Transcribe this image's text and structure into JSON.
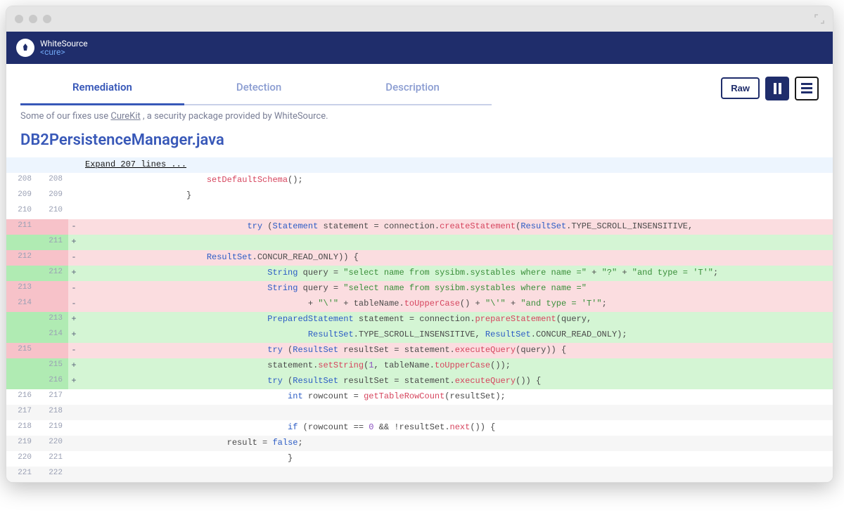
{
  "brand": {
    "name_top": "WhiteSource",
    "name_bottom": "<cure>"
  },
  "tabs": {
    "remediation": "Remediation",
    "detection": "Detection",
    "description": "Description"
  },
  "controls": {
    "raw": "Raw"
  },
  "info": {
    "prefix": "Some of our fixes use ",
    "link": "CureKit",
    "suffix": " , a security package provided by WhiteSource."
  },
  "file": {
    "name": "DB2PersistenceManager.java"
  },
  "expand": "Expand 207 lines ...",
  "diff": [
    {
      "t": "ctx",
      "ol": "208",
      "nl": "208",
      "segs": [
        [
          "pad",
          "                        "
        ],
        [
          "mth",
          "setDefaultSchema"
        ],
        [
          "op",
          "();"
        ]
      ]
    },
    {
      "t": "ctx",
      "ol": "209",
      "nl": "209",
      "segs": [
        [
          "pad",
          "                    "
        ],
        [
          "op",
          "}"
        ]
      ]
    },
    {
      "t": "ctx",
      "ol": "210",
      "nl": "210",
      "segs": [
        [
          "pad",
          ""
        ]
      ]
    },
    {
      "t": "del",
      "ol": "211",
      "nl": "",
      "segs": [
        [
          "pad",
          "                                "
        ],
        [
          "kw",
          "try"
        ],
        [
          "op",
          " ("
        ],
        [
          "type",
          "Statement"
        ],
        [
          "id",
          " statement "
        ],
        [
          "op",
          "= "
        ],
        [
          "id",
          "connection"
        ],
        [
          "op",
          "."
        ],
        [
          "mth",
          "createStatement"
        ],
        [
          "op",
          "("
        ],
        [
          "type",
          "ResultSet"
        ],
        [
          "op",
          "."
        ],
        [
          "id",
          "TYPE_SCROLL_INSENSITIVE"
        ],
        [
          "op",
          ","
        ]
      ]
    },
    {
      "t": "add",
      "ol": "",
      "nl": "211",
      "segs": [
        [
          "pad",
          ""
        ]
      ]
    },
    {
      "t": "del",
      "ol": "212",
      "nl": "",
      "segs": [
        [
          "pad",
          "                        "
        ],
        [
          "type",
          "ResultSet"
        ],
        [
          "op",
          "."
        ],
        [
          "id",
          "CONCUR_READ_ONLY"
        ],
        [
          "op",
          ")) {"
        ]
      ]
    },
    {
      "t": "add",
      "ol": "",
      "nl": "212",
      "segs": [
        [
          "pad",
          "                                    "
        ],
        [
          "type",
          "String"
        ],
        [
          "id",
          " query "
        ],
        [
          "op",
          "= "
        ],
        [
          "str",
          "\"select name from sysibm.systables where name =\""
        ],
        [
          "op",
          " + "
        ],
        [
          "str",
          "\"?\""
        ],
        [
          "op",
          " + "
        ],
        [
          "str",
          "\"and type = 'T'\""
        ],
        [
          "op",
          ";"
        ]
      ]
    },
    {
      "t": "del",
      "ol": "213",
      "nl": "",
      "segs": [
        [
          "pad",
          "                                    "
        ],
        [
          "type",
          "String"
        ],
        [
          "id",
          " query "
        ],
        [
          "op",
          "= "
        ],
        [
          "str",
          "\"select name from sysibm.systables where name =\""
        ]
      ]
    },
    {
      "t": "del",
      "ol": "214",
      "nl": "",
      "segs": [
        [
          "pad",
          "                                            "
        ],
        [
          "op",
          "+ "
        ],
        [
          "str",
          "\"\\'\""
        ],
        [
          "op",
          " + "
        ],
        [
          "id",
          "tableName"
        ],
        [
          "op",
          "."
        ],
        [
          "mth",
          "toUpperCase"
        ],
        [
          "op",
          "() + "
        ],
        [
          "str",
          "\"\\'\""
        ],
        [
          "op",
          " + "
        ],
        [
          "str",
          "\"and type = 'T'\""
        ],
        [
          "op",
          ";"
        ]
      ]
    },
    {
      "t": "add",
      "ol": "",
      "nl": "213",
      "segs": [
        [
          "pad",
          "                                    "
        ],
        [
          "type",
          "PreparedStatement"
        ],
        [
          "id",
          " statement "
        ],
        [
          "op",
          "= "
        ],
        [
          "id",
          "connection"
        ],
        [
          "op",
          "."
        ],
        [
          "mth",
          "prepareStatement"
        ],
        [
          "op",
          "("
        ],
        [
          "id",
          "query"
        ],
        [
          "op",
          ","
        ]
      ]
    },
    {
      "t": "add",
      "ol": "",
      "nl": "214",
      "segs": [
        [
          "pad",
          "                                            "
        ],
        [
          "type",
          "ResultSet"
        ],
        [
          "op",
          "."
        ],
        [
          "id",
          "TYPE_SCROLL_INSENSITIVE"
        ],
        [
          "op",
          ", "
        ],
        [
          "type",
          "ResultSet"
        ],
        [
          "op",
          "."
        ],
        [
          "id",
          "CONCUR_READ_ONLY"
        ],
        [
          "op",
          ");"
        ]
      ]
    },
    {
      "t": "del",
      "ol": "215",
      "nl": "",
      "segs": [
        [
          "pad",
          "                                    "
        ],
        [
          "kw",
          "try"
        ],
        [
          "op",
          " ("
        ],
        [
          "type",
          "ResultSet"
        ],
        [
          "id",
          " resultSet "
        ],
        [
          "op",
          "= "
        ],
        [
          "id",
          "statement"
        ],
        [
          "op",
          "."
        ],
        [
          "mth",
          "executeQuery"
        ],
        [
          "op",
          "("
        ],
        [
          "id",
          "query"
        ],
        [
          "op",
          ")) {"
        ]
      ]
    },
    {
      "t": "add",
      "ol": "",
      "nl": "215",
      "segs": [
        [
          "pad",
          "                                    "
        ],
        [
          "id",
          "statement"
        ],
        [
          "op",
          "."
        ],
        [
          "mth",
          "setString"
        ],
        [
          "op",
          "("
        ],
        [
          "num",
          "1"
        ],
        [
          "op",
          ", "
        ],
        [
          "id",
          "tableName"
        ],
        [
          "op",
          "."
        ],
        [
          "mth",
          "toUpperCase"
        ],
        [
          "op",
          "());"
        ]
      ]
    },
    {
      "t": "add",
      "ol": "",
      "nl": "216",
      "segs": [
        [
          "pad",
          "                                    "
        ],
        [
          "kw",
          "try"
        ],
        [
          "op",
          " ("
        ],
        [
          "type",
          "ResultSet"
        ],
        [
          "id",
          " resultSet "
        ],
        [
          "op",
          "= "
        ],
        [
          "id",
          "statement"
        ],
        [
          "op",
          "."
        ],
        [
          "mth",
          "executeQuery"
        ],
        [
          "op",
          "()) {"
        ]
      ]
    },
    {
      "t": "ctx",
      "ol": "216",
      "nl": "217",
      "segs": [
        [
          "pad",
          "                                        "
        ],
        [
          "kw",
          "int"
        ],
        [
          "id",
          " rowcount "
        ],
        [
          "op",
          "= "
        ],
        [
          "mth",
          "getTableRowCount"
        ],
        [
          "op",
          "("
        ],
        [
          "id",
          "resultSet"
        ],
        [
          "op",
          ");"
        ]
      ]
    },
    {
      "t": "ctx2",
      "ol": "217",
      "nl": "218",
      "segs": [
        [
          "pad",
          ""
        ]
      ]
    },
    {
      "t": "ctx",
      "ol": "218",
      "nl": "219",
      "segs": [
        [
          "pad",
          "                                        "
        ],
        [
          "kw",
          "if"
        ],
        [
          "op",
          " ("
        ],
        [
          "id",
          "rowcount"
        ],
        [
          "op",
          " == "
        ],
        [
          "num",
          "0"
        ],
        [
          "op",
          " && !"
        ],
        [
          "id",
          "resultSet"
        ],
        [
          "op",
          "."
        ],
        [
          "mth",
          "next"
        ],
        [
          "op",
          "()) {"
        ]
      ]
    },
    {
      "t": "ctx2",
      "ol": "219",
      "nl": "220",
      "segs": [
        [
          "pad",
          "                            "
        ],
        [
          "id",
          "result"
        ],
        [
          "op",
          " = "
        ],
        [
          "kw",
          "false"
        ],
        [
          "op",
          ";"
        ]
      ]
    },
    {
      "t": "ctx",
      "ol": "220",
      "nl": "221",
      "segs": [
        [
          "pad",
          "                                        "
        ],
        [
          "op",
          "}"
        ]
      ]
    },
    {
      "t": "ctx2",
      "ol": "221",
      "nl": "222",
      "segs": [
        [
          "pad",
          ""
        ]
      ]
    }
  ]
}
